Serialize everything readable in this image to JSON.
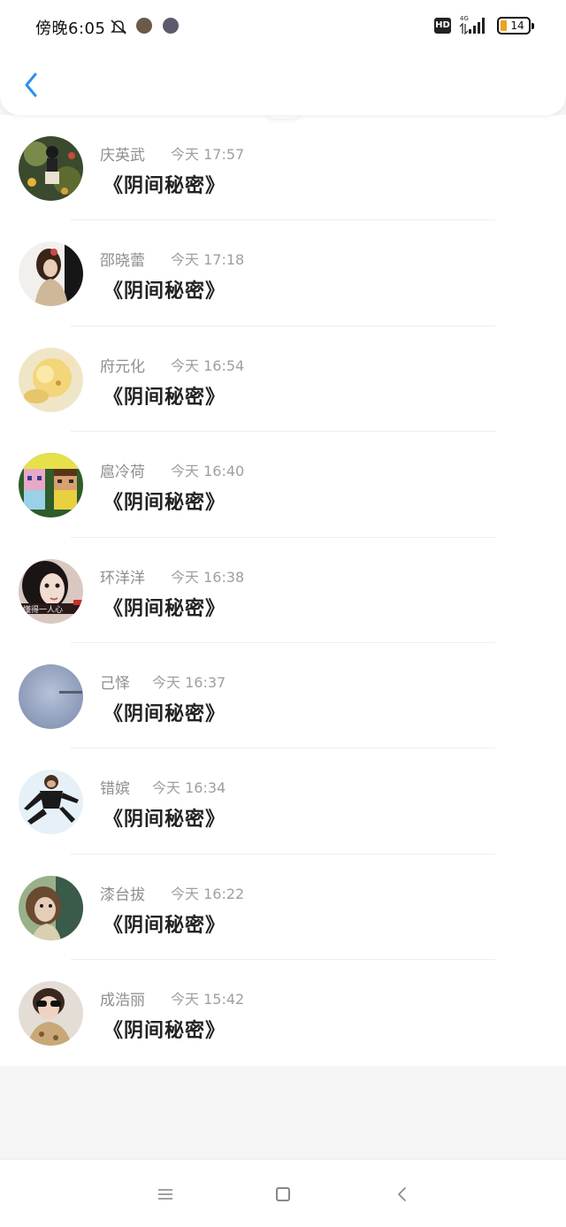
{
  "status_bar": {
    "time": "傍晚6:05",
    "hd": "HD",
    "network": "4G",
    "battery": "14"
  },
  "header": {
    "back_icon": "chevron-left-icon"
  },
  "messages": [
    {
      "name": "庆英武",
      "time": "今天 17:57",
      "text": "《阴间秘密》"
    },
    {
      "name": "邵晓蕾",
      "time": "今天 17:18",
      "text": "《阴间秘密》"
    },
    {
      "name": "府元化",
      "time": "今天 16:54",
      "text": "《阴间秘密》"
    },
    {
      "name": "扈冷荷",
      "time": "今天 16:40",
      "text": "《阴间秘密》"
    },
    {
      "name": "环洋洋",
      "time": "今天 16:38",
      "text": "《阴间秘密》"
    },
    {
      "name": "己怿",
      "time": "今天 16:37",
      "text": "《阴间秘密》"
    },
    {
      "name": "错嫔",
      "time": "今天 16:34",
      "text": "《阴间秘密》"
    },
    {
      "name": "漆台拔",
      "time": "今天 16:22",
      "text": "《阴间秘密》"
    },
    {
      "name": "成浩丽",
      "time": "今天 15:42",
      "text": "《阴间秘密》"
    }
  ],
  "avatar_texts": {
    "avatar_5": "懂得一人心"
  },
  "nav": {
    "menu_icon": "menu-icon",
    "home_icon": "home-square-icon",
    "back_icon": "back-triangle-icon"
  },
  "colors": {
    "accent": "#2c8ff0",
    "name": "#8e8e8e",
    "time": "#9f9f9f",
    "message": "#222222"
  }
}
